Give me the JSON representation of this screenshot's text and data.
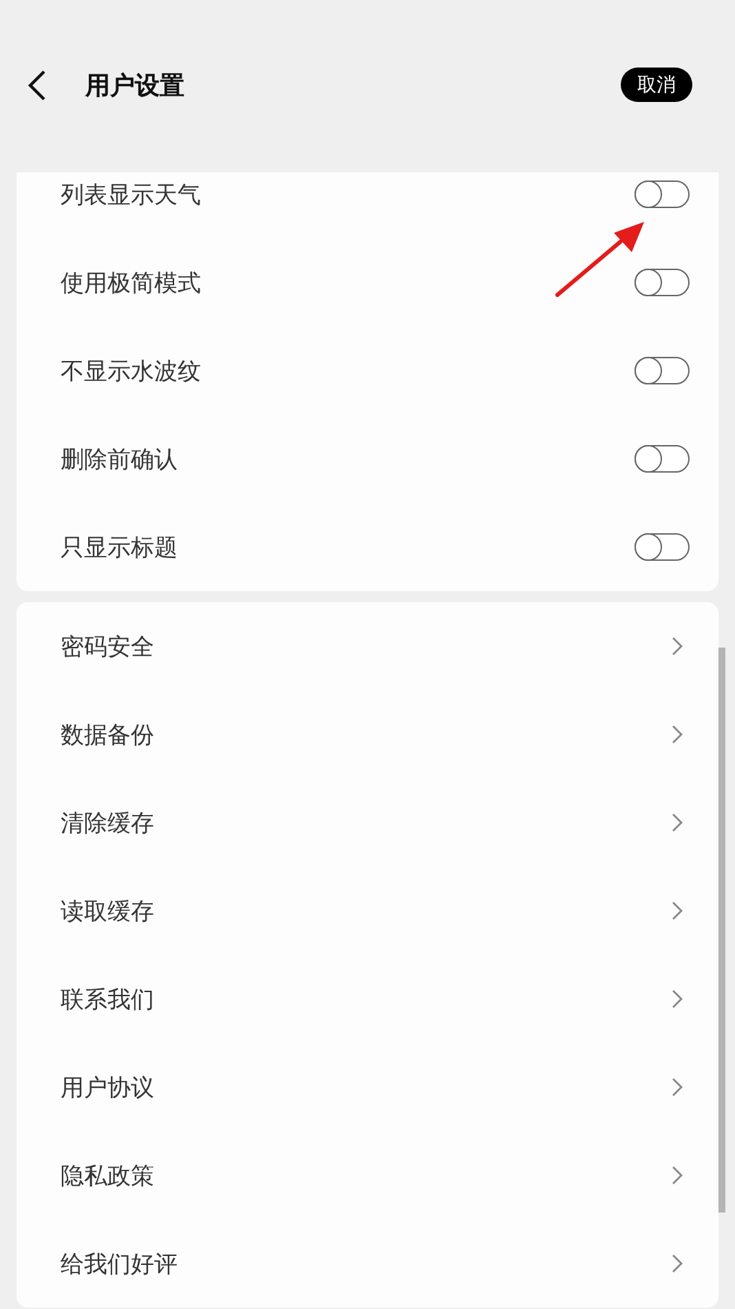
{
  "header": {
    "title": "用户设置",
    "cancel_button": "取消"
  },
  "toggle_settings": [
    {
      "label": "列表显示天气",
      "on": false
    },
    {
      "label": "使用极简模式",
      "on": false
    },
    {
      "label": "不显示水波纹",
      "on": false
    },
    {
      "label": "删除前确认",
      "on": false
    },
    {
      "label": "只显示标题",
      "on": false
    }
  ],
  "menu_items": [
    {
      "label": "密码安全"
    },
    {
      "label": "数据备份"
    },
    {
      "label": "清除缓存"
    },
    {
      "label": "读取缓存"
    },
    {
      "label": "联系我们"
    },
    {
      "label": "用户协议"
    },
    {
      "label": "隐私政策"
    },
    {
      "label": "给我们好评"
    }
  ]
}
